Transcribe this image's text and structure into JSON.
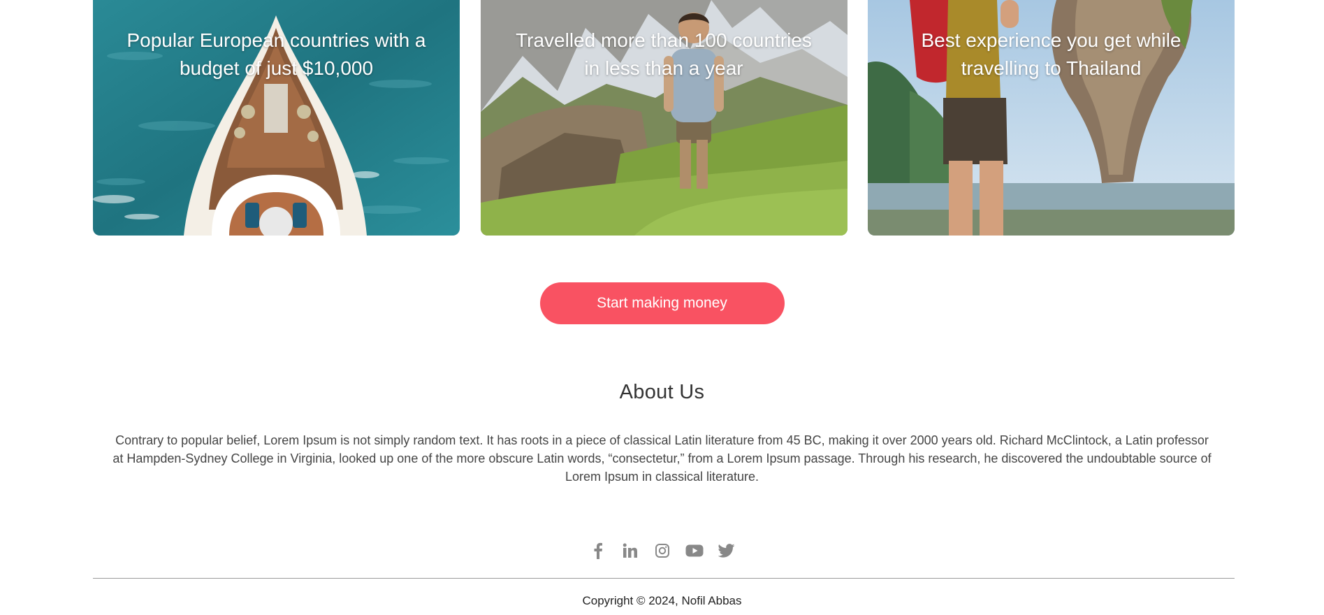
{
  "colors": {
    "accent": "#f95262",
    "icon": "#888888",
    "text_dark": "#333333"
  },
  "cards": [
    {
      "title": "Popular European countries with a budget of just $10,000",
      "image": "yacht-on-sea-aerial"
    },
    {
      "title": "Travelled more than 100 countries in less than a year",
      "image": "hiker-on-mountain-ridge"
    },
    {
      "title": "Best experience you get while travelling to Thailand",
      "image": "backpacker-at-thailand-rock"
    }
  ],
  "cta": {
    "label": "Start making money"
  },
  "about": {
    "title": "About Us",
    "text": "Contrary to popular belief, Lorem Ipsum is not simply random text. It has roots in a piece of classical Latin literature from 45 BC, making it over 2000 years old. Richard McClintock, a Latin professor at Hampden-Sydney College in Virginia, looked up one of the more obscure Latin words, “consectetur,” from a Lorem Ipsum passage. Through his research, he discovered the undoubtable source of Lorem Ipsum in classical literature."
  },
  "social": [
    {
      "name": "facebook-icon"
    },
    {
      "name": "linkedin-icon"
    },
    {
      "name": "instagram-icon"
    },
    {
      "name": "youtube-icon"
    },
    {
      "name": "twitter-icon"
    }
  ],
  "footer": {
    "copyright": "Copyright © 2024, Nofil Abbas"
  }
}
